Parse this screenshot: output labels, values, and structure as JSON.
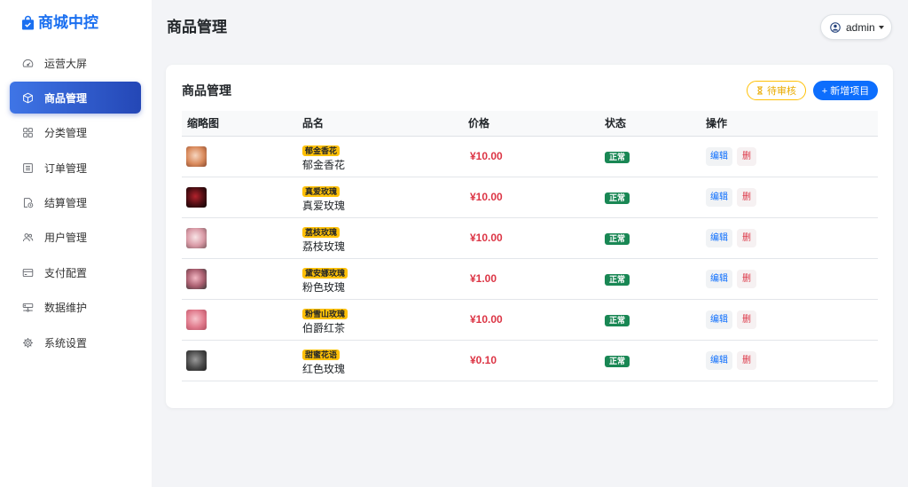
{
  "app": {
    "brand": "商城中控",
    "brand_icon": "bag-check-icon"
  },
  "theme": {
    "brand": "#1a6ff0",
    "primary": "#0d6efd",
    "danger": "#dc3545",
    "success": "#198754",
    "warning": "#ffc107",
    "active_gradient": [
      "#3f75e6",
      "#2447b6"
    ]
  },
  "sidebar": {
    "items": [
      {
        "label": "运营大屏",
        "icon": "speedometer-icon",
        "active": false
      },
      {
        "label": "商品管理",
        "icon": "box-icon",
        "active": true
      },
      {
        "label": "分类管理",
        "icon": "grid-icon",
        "active": false
      },
      {
        "label": "订单管理",
        "icon": "list-icon",
        "active": false
      },
      {
        "label": "结算管理",
        "icon": "file-clock-icon",
        "active": false
      },
      {
        "label": "用户管理",
        "icon": "people-icon",
        "active": false
      },
      {
        "label": "支付配置",
        "icon": "credit-card-icon",
        "active": false
      },
      {
        "label": "数据维护",
        "icon": "hdd-network-icon",
        "active": false
      },
      {
        "label": "系统设置",
        "icon": "gear-icon",
        "active": false
      }
    ]
  },
  "header": {
    "title": "商品管理",
    "user": {
      "name": "admin",
      "icon": "person-circle-icon",
      "dropdown_icon": "caret-down-icon"
    }
  },
  "card": {
    "title": "商品管理",
    "pending_button": {
      "label": "待审核",
      "icon": "hourglass-icon"
    },
    "add_button": {
      "label": "+ 新增项目"
    },
    "table": {
      "columns": [
        "缩略图",
        "品名",
        "价格",
        "状态",
        "操作"
      ],
      "rows": [
        {
          "tag": "郁金香花",
          "name": "郁金香花",
          "price": "¥10.00",
          "status": "正常",
          "edit": "编辑",
          "delete": "删",
          "thumb_colors": [
            "#f6d5bf",
            "#d98a5c",
            "#8a4a2e"
          ]
        },
        {
          "tag": "真爱玫瑰",
          "name": "真爱玫瑰",
          "price": "¥10.00",
          "status": "正常",
          "edit": "编辑",
          "delete": "删",
          "thumb_colors": [
            "#b3222c",
            "#4a0d12",
            "#0d0506"
          ]
        },
        {
          "tag": "荔枝玫瑰",
          "name": "荔枝玫瑰",
          "price": "¥10.00",
          "status": "正常",
          "edit": "编辑",
          "delete": "删",
          "thumb_colors": [
            "#f8e4e6",
            "#d99aa6",
            "#7d5a5f"
          ]
        },
        {
          "tag": "黛安娜玫瑰",
          "name": "粉色玫瑰",
          "price": "¥1.00",
          "status": "正常",
          "edit": "编辑",
          "delete": "删",
          "thumb_colors": [
            "#f3b7c3",
            "#a85d6e",
            "#3a3a3a"
          ]
        },
        {
          "tag": "粉雪山玫瑰",
          "name": "伯爵红茶",
          "price": "¥10.00",
          "status": "正常",
          "edit": "编辑",
          "delete": "删",
          "thumb_colors": [
            "#f7c4cc",
            "#e07a8c",
            "#b04e60"
          ]
        },
        {
          "tag": "甜蜜花语",
          "name": "红色玫瑰",
          "price": "¥0.10",
          "status": "正常",
          "edit": "编辑",
          "delete": "删",
          "thumb_colors": [
            "#9a9a9a",
            "#4a4a4a",
            "#1f1f1f"
          ]
        }
      ]
    }
  }
}
